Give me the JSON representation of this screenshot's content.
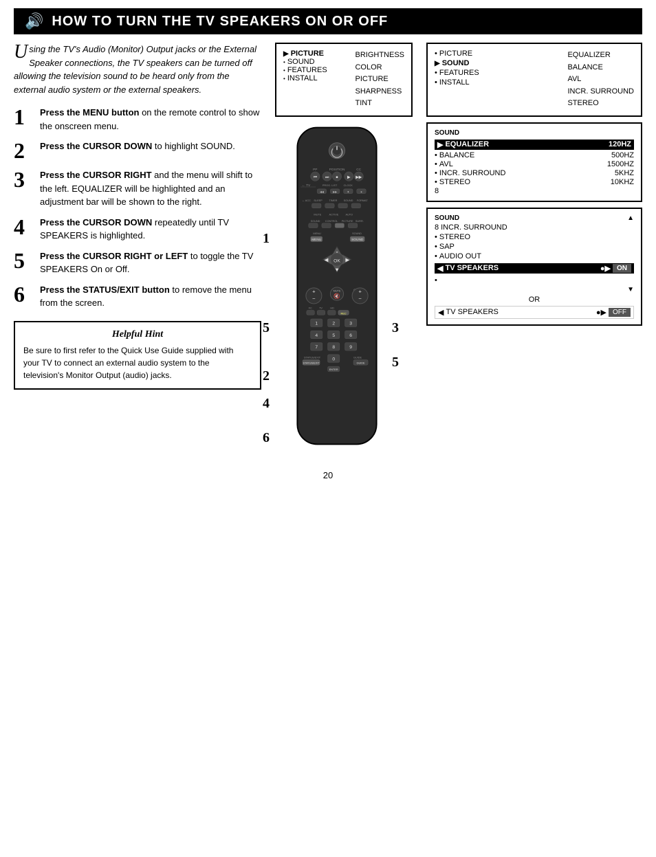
{
  "header": {
    "title": "How to Turn the TV Speakers On or Off",
    "icon": "🔊"
  },
  "intro": {
    "drop_cap": "U",
    "text": "sing the TV's Audio (Monitor) Output jacks or the External Speaker connections, the TV speakers can be turned off allowing the television sound to be heard only from the external audio system or the external speakers."
  },
  "steps": [
    {
      "number": "1",
      "text_parts": [
        {
          "bold": true,
          "text": "Press the MENU button"
        },
        {
          "bold": false,
          "text": " on the remote control to show the onscreen menu."
        }
      ]
    },
    {
      "number": "2",
      "text_parts": [
        {
          "bold": true,
          "text": "Press the CURSOR DOWN"
        },
        {
          "bold": false,
          "text": " to highlight SOUND."
        }
      ]
    },
    {
      "number": "3",
      "text_parts": [
        {
          "bold": true,
          "text": "Press the CURSOR RIGHT"
        },
        {
          "bold": false,
          "text": " and the menu will shift to the left. EQUALIZER will be highlighted and an adjustment bar will be shown to the right."
        }
      ]
    },
    {
      "number": "4",
      "text_parts": [
        {
          "bold": true,
          "text": "Press the CURSOR DOWN"
        },
        {
          "bold": false,
          "text": " repeatedly until TV SPEAKERS is highlighted."
        }
      ]
    },
    {
      "number": "5",
      "text_parts": [
        {
          "bold": true,
          "text": "Press the CURSOR RIGHT or LEFT"
        },
        {
          "bold": false,
          "text": " to toggle the TV SPEAKERS On or Off."
        }
      ]
    },
    {
      "number": "6",
      "text_parts": [
        {
          "bold": true,
          "text": "Press the STATUS/EXIT button"
        },
        {
          "bold": false,
          "text": " to remove the menu from the screen."
        }
      ]
    }
  ],
  "hint": {
    "title": "Helpful Hint",
    "text": "Be sure to first refer to the Quick Use Guide supplied with your TV to connect an external audio system to the television's Monitor Output (audio) jacks."
  },
  "menu1": {
    "items_left": [
      "PICTURE",
      "SOUND",
      "FEATURES",
      "INSTALL"
    ],
    "items_right": [
      "BRIGHTNESS",
      "COLOR",
      "PICTURE",
      "SHARPNESS",
      "TINT"
    ],
    "selected": "PICTURE"
  },
  "menu2": {
    "label": "",
    "items": [
      {
        "left": "PICTURE",
        "right": "EQUALIZER"
      },
      {
        "left": "SOUND",
        "right": "BALANCE",
        "selected": true
      },
      {
        "left": "FEATURES",
        "right": "AVL"
      },
      {
        "left": "INSTALL",
        "right": "INCR. SURROUND"
      }
    ],
    "extra_right": "STEREO"
  },
  "menu3": {
    "label": "SOUND",
    "items": [
      {
        "left": "EQUALIZER",
        "right": "120HZ",
        "selected": true
      },
      {
        "left": "BALANCE",
        "right": "500HZ"
      },
      {
        "left": "AVL",
        "right": "1500HZ"
      },
      {
        "left": "INCR. SURROUND",
        "right": "5KHZ"
      },
      {
        "left": "STEREO",
        "right": "10KHZ"
      },
      {
        "left": "8",
        "right": ""
      }
    ]
  },
  "menu4": {
    "label": "SOUND",
    "items": [
      {
        "left": "INCR. SURROUND",
        "bullet": true
      },
      {
        "left": "STEREO",
        "bullet": true
      },
      {
        "left": "SAP",
        "bullet": true
      },
      {
        "left": "AUDIO OUT",
        "bullet": true
      }
    ],
    "tv_speakers_on": {
      "label": "TV SPEAKERS",
      "value": "ON"
    },
    "tv_speakers_off": {
      "label": "TV SPEAKERS",
      "value": "OFF"
    },
    "divider": "OR"
  },
  "page_number": "20"
}
